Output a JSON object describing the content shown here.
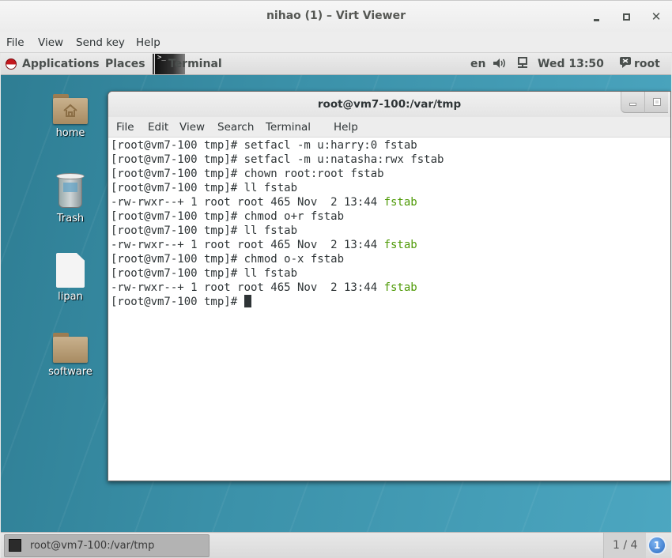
{
  "window": {
    "title": "nihao (1) – Virt Viewer",
    "controls": {
      "minimize": "minimize",
      "maximize": "maximize",
      "close": "close"
    }
  },
  "viewer_menu": [
    "File",
    "View",
    "Send key",
    "Help"
  ],
  "guest_topbar": {
    "applications": "Applications",
    "places": "Places",
    "active_task": "Terminal",
    "input_language": "en",
    "clock": "Wed 13:50",
    "user": "root",
    "icons": [
      "redhat-icon",
      "terminal-icon",
      "volume-icon",
      "network-icon",
      "user-icon"
    ]
  },
  "desktop_icons": [
    {
      "label": "home",
      "icon": "home-folder-icon"
    },
    {
      "label": "Trash",
      "icon": "trash-icon"
    },
    {
      "label": "lipan",
      "icon": "file-icon"
    },
    {
      "label": "software",
      "icon": "folder-icon"
    }
  ],
  "terminal": {
    "title": "root@vm7-100:/var/tmp",
    "menu": [
      "File",
      "Edit",
      "View",
      "Search",
      "Terminal",
      "Help"
    ],
    "lines": [
      {
        "text": "[root@vm7-100 tmp]# setfacl -m u:harry:0 fstab",
        "highlight": ""
      },
      {
        "text": "[root@vm7-100 tmp]# setfacl -m u:natasha:rwx fstab",
        "highlight": ""
      },
      {
        "text": "[root@vm7-100 tmp]# chown root:root fstab",
        "highlight": ""
      },
      {
        "text": "[root@vm7-100 tmp]# ll fstab",
        "highlight": ""
      },
      {
        "text": "-rw-rwxr--+ 1 root root 465 Nov  2 13:44 ",
        "highlight": "fstab"
      },
      {
        "text": "[root@vm7-100 tmp]# chmod o+r fstab",
        "highlight": ""
      },
      {
        "text": "[root@vm7-100 tmp]# ll fstab",
        "highlight": ""
      },
      {
        "text": "-rw-rwxr--+ 1 root root 465 Nov  2 13:44 ",
        "highlight": "fstab"
      },
      {
        "text": "[root@vm7-100 tmp]# chmod o-x fstab",
        "highlight": ""
      },
      {
        "text": "[root@vm7-100 tmp]# ll fstab",
        "highlight": ""
      },
      {
        "text": "-rw-rwxr--+ 1 root root 465 Nov  2 13:44 ",
        "highlight": "fstab"
      }
    ],
    "prompt": "[root@vm7-100 tmp]# ",
    "highlight_color": "#4e9a06"
  },
  "bottom_panel": {
    "task_label": "root@vm7-100:/var/tmp",
    "workspace": "1 / 4",
    "notification_count": "1"
  }
}
